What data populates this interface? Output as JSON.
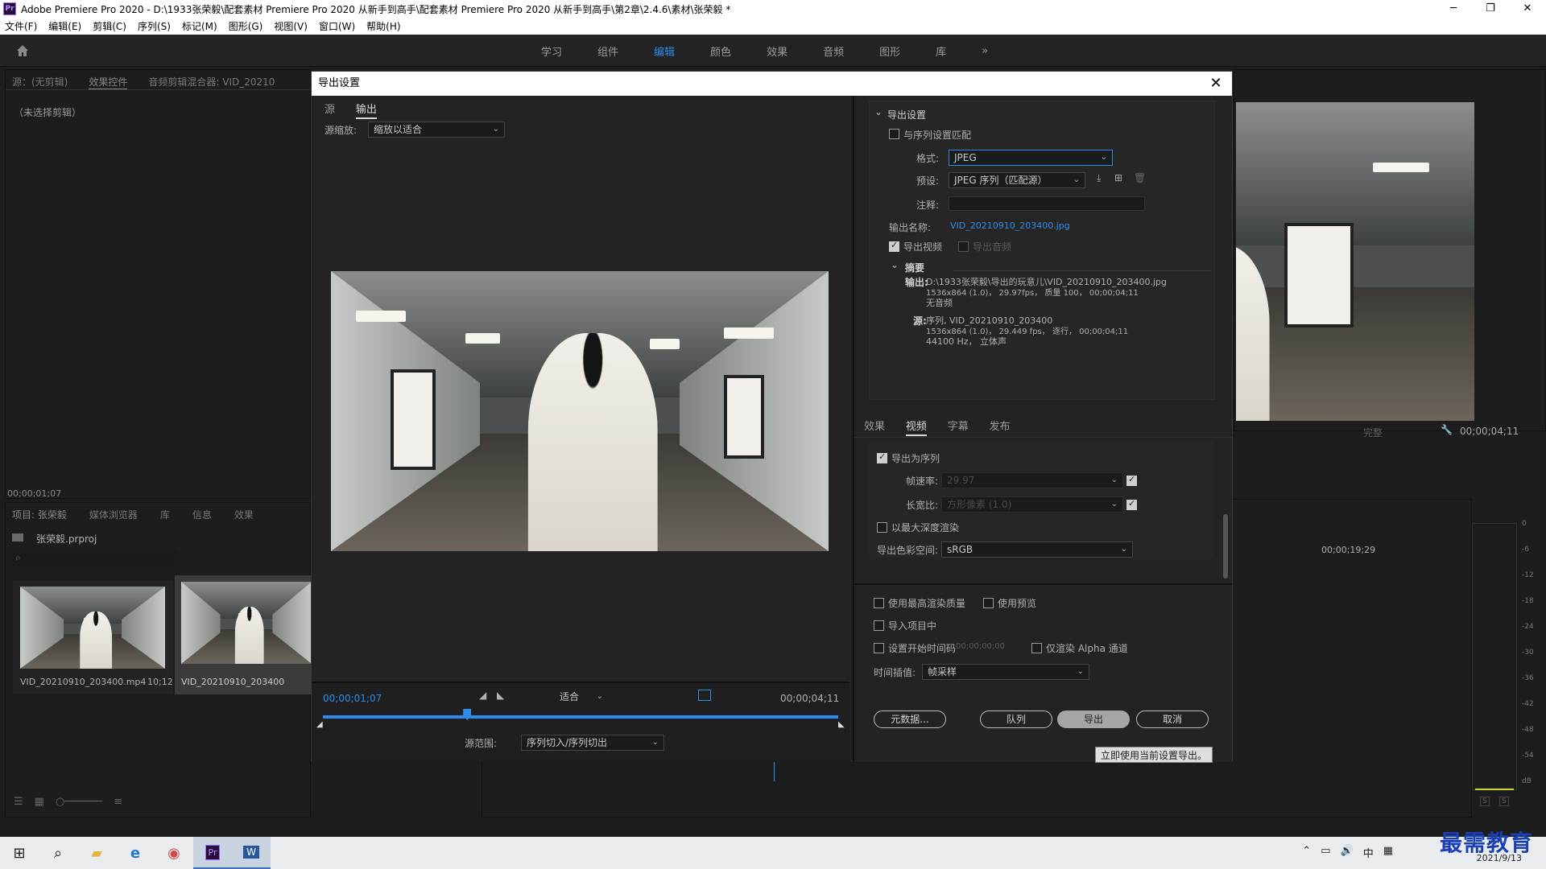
{
  "titlebar": {
    "title": "Adobe Premiere Pro 2020 - D:\\1933张荣毅\\配套素材 Premiere Pro 2020 从新手到高手\\配套素材 Premiere Pro 2020 从新手到高手\\第2章\\2.4.6\\素材\\张荣毅 *",
    "logo": "Pr"
  },
  "menu": [
    "文件(F)",
    "编辑(E)",
    "剪辑(C)",
    "序列(S)",
    "标记(M)",
    "图形(G)",
    "视图(V)",
    "窗口(W)",
    "帮助(H)"
  ],
  "workspaces": [
    {
      "label": "学习",
      "active": false
    },
    {
      "label": "组件",
      "active": false
    },
    {
      "label": "编辑",
      "active": true
    },
    {
      "label": "颜色",
      "active": false
    },
    {
      "label": "效果",
      "active": false
    },
    {
      "label": "音频",
      "active": false
    },
    {
      "label": "图形",
      "active": false
    },
    {
      "label": "库",
      "active": false
    }
  ],
  "source_panel": {
    "tabs": [
      "源：(无剪辑)",
      "效果控件",
      "音频剪辑混合器: VID_20210"
    ],
    "empty": "（未选择剪辑）",
    "timecode": "00;00;01;07"
  },
  "project_panel": {
    "tabs": [
      "项目: 张荣毅",
      "媒体浏览器",
      "库",
      "信息",
      "效果"
    ],
    "project_file": "张荣毅.prproj",
    "items": [
      {
        "name": "VID_20210910_203400.mp4",
        "duration": "10;12"
      },
      {
        "name": "VID_20210910_203400",
        "duration": ""
      }
    ]
  },
  "program_monitor": {
    "fit": "完整",
    "timecode": "00;00;04;11",
    "timeline_time": "00;00;19;29",
    "meter_scale": [
      "0",
      "-6",
      "-12",
      "-18",
      "-24",
      "-30",
      "-36",
      "-42",
      "-48",
      "-54",
      "dB"
    ],
    "meter_solo": [
      "S",
      "S"
    ]
  },
  "dialog": {
    "title": "导出设置",
    "left": {
      "tabs": [
        {
          "label": "源",
          "active": false
        },
        {
          "label": "输出",
          "active": true
        }
      ],
      "scaling_label": "源缩放:",
      "scaling_value": "缩放以适合",
      "current_time": "00;00;01;07",
      "fit_value": "适合",
      "end_time": "00;00;04;11",
      "range_label": "源范围:",
      "range_value": "序列切入/序列切出",
      "playhead_fraction": 0.28
    },
    "export_settings": {
      "section": "导出设置",
      "match_sequence": "与序列设置匹配",
      "format_label": "格式:",
      "format_value": "JPEG",
      "preset_label": "预设:",
      "preset_value": "JPEG 序列（匹配源）",
      "comment_label": "注释:",
      "output_name_label": "输出名称:",
      "output_name_value": "VID_20210910_203400.jpg",
      "export_video": "导出视频",
      "export_audio": "导出音频",
      "summary_title": "摘要",
      "output_label": "输出:",
      "output_lines": [
        "D:\\1933张荣毅\\导出的玩意儿\\VID_20210910_203400.jpg",
        "1536x864 (1.0)， 29.97fps， 质量 100， 00;00;04;11",
        "无音频"
      ],
      "source_label": "源:",
      "source_lines": [
        "序列, VID_20210910_203400",
        "1536x864 (1.0)， 29.449 fps， 逐行， 00;00;04;11",
        "44100 Hz， 立体声"
      ]
    },
    "settings_tabs": [
      {
        "label": "效果",
        "active": false
      },
      {
        "label": "视频",
        "active": true
      },
      {
        "label": "字幕",
        "active": false
      },
      {
        "label": "发布",
        "active": false
      }
    ],
    "video": {
      "export_as_sequence": "导出为序列",
      "frame_rate_label": "帧速率:",
      "frame_rate_value": "29.97",
      "aspect_label": "长宽比:",
      "aspect_value": "方形像素 (1.0)",
      "max_depth": "以最大深度渲染",
      "color_space_label": "导出色彩空间:",
      "color_space_value": "sRGB"
    },
    "bottom": {
      "max_quality": "使用最高渲染质量",
      "use_previews": "使用预览",
      "import_project": "导入项目中",
      "start_timecode": "设置开始时间码",
      "start_timecode_value": "00;00;00;00",
      "alpha_only": "仅渲染 Alpha 通道",
      "interp_label": "时间插值:",
      "interp_value": "帧采样"
    },
    "buttons": {
      "metadata": "元数据...",
      "queue": "队列",
      "export": "导出",
      "cancel": "取消"
    },
    "tooltip": "立即使用当前设置导出。"
  },
  "taskbar": {
    "time": "2021/9/13",
    "ime": "中",
    "icons": [
      "windows-start-icon",
      "search-icon",
      "file-explorer-icon",
      "edge-icon",
      "paint-icon",
      "premiere-icon",
      "word-icon"
    ]
  },
  "watermark": "最需教育"
}
